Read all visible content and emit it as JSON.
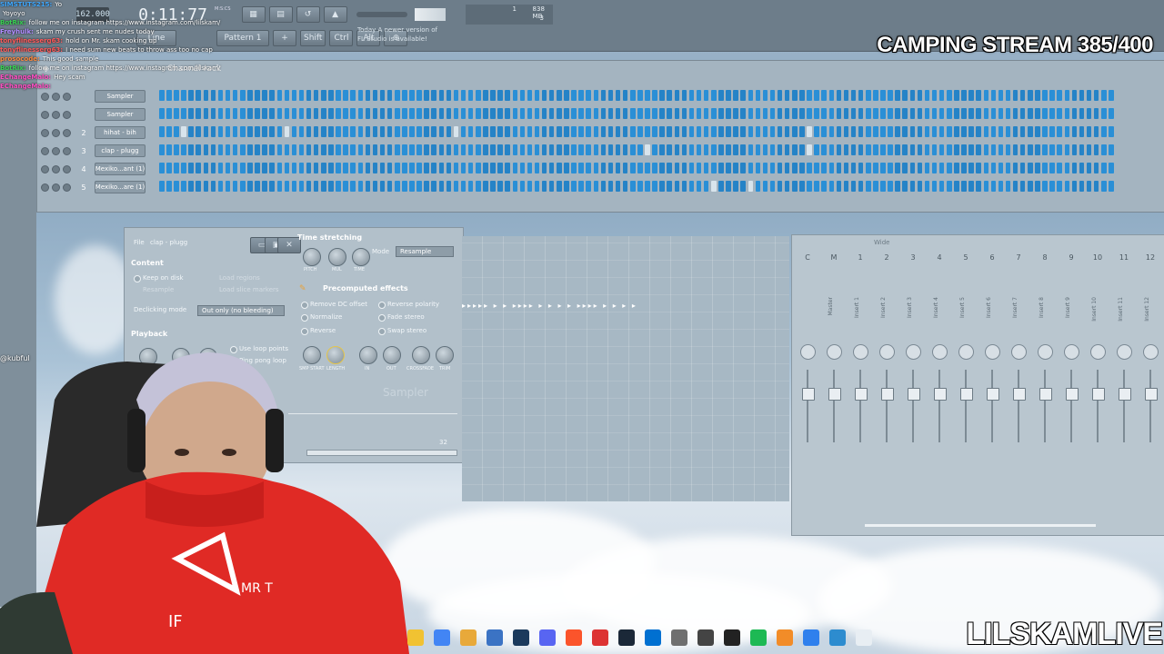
{
  "stream": {
    "title": "CAMPING STREAM 385/400",
    "watermark": "LILSKAMLIVE",
    "side_tag": "@kubful"
  },
  "fl_toolbar": {
    "tempo": "162.000",
    "time": "0:11:77",
    "time_unit": "M:S:CS",
    "pattern": "Pattern 1",
    "mode": "Line",
    "memory": "838 MB",
    "cpu": "1",
    "poly": "3",
    "hint_line1": "Today A newer version of",
    "hint_line2": "FL Studio is available!",
    "shift": "Shift",
    "ctrl": "Ctrl",
    "alt": "Alt"
  },
  "chat": [
    {
      "user": "SIMSTUTS215:",
      "text": "Yo",
      "color": "#3ea8ff"
    },
    {
      "user": "",
      "text": "Yoyoyo",
      "color": "#ffffff"
    },
    {
      "user": "BotRix:",
      "text": "follow me on instagram https://www.instagram.com/lilskam/",
      "color": "#39d353"
    },
    {
      "user": "Freyhulk:",
      "text": "skam my crush sent me nudes today",
      "color": "#b18bff"
    },
    {
      "user": "tonyflinesserg63:",
      "text": "hold on Mr. skam cooking up",
      "color": "#ff5a5a"
    },
    {
      "user": "tonyflinesserg63:",
      "text": "I need sum new beats to throw ass too no cap",
      "color": "#ff5a5a"
    },
    {
      "user": "prosocode:",
      "text": "This good sample",
      "color": "#ff8a3d"
    },
    {
      "user": "BotRix:",
      "text": "follow me on instagram https://www.instagram.com/lilskam/",
      "color": "#39d353"
    },
    {
      "user": "EChangeMalo:",
      "text": "Hey scam",
      "color": "#ff4fc3"
    },
    {
      "user": "EChangeMalo:",
      "text": "",
      "color": "#ff4fc3"
    }
  ],
  "channel_rack": {
    "title": "Channel rack",
    "channels": [
      {
        "num": "",
        "name": "Sampler"
      },
      {
        "num": "",
        "name": "Sampler"
      },
      {
        "num": "2",
        "name": "hihat - bih"
      },
      {
        "num": "3",
        "name": "clap - plugg"
      },
      {
        "num": "4",
        "name": "Mexiko...ant (1)"
      },
      {
        "num": "5",
        "name": "Mexiko...are (1)"
      }
    ]
  },
  "sampler": {
    "file_label": "File",
    "file_name": "clap - plugg",
    "content_label": "Content",
    "keep_on_disk": "Keep on disk",
    "resample": "Resample",
    "load_regions": "Load regions",
    "load_slice_markers": "Load slice markers",
    "declicking_label": "Declicking mode",
    "declicking_value": "Out only (no bleeding)",
    "time_stretching": "Time stretching",
    "mode_label": "Mode",
    "mode_value": "Resample",
    "knob_pitch": "PITCH",
    "knob_mul": "MUL",
    "knob_time": "TIME",
    "precomputed": "Precomputed effects",
    "remove_dc": "Remove DC offset",
    "normalize": "Normalize",
    "reverse": "Reverse",
    "reverse_polarity": "Reverse polarity",
    "fade_stereo": "Fade stereo",
    "swap_stereo": "Swap stereo",
    "playback": "Playback",
    "use_loop_points": "Use loop points",
    "ping_pong": "Ping pong loop",
    "knob_smp_start": "SMP START",
    "knob_length": "LENGTH",
    "knob_in": "IN",
    "knob_out": "OUT",
    "knob_crossfade": "CROSSFADE",
    "knob_trim": "TRIM",
    "brand": "Sampler",
    "counter": "32"
  },
  "mixer": {
    "header": "Wide",
    "strips": [
      {
        "num": "C",
        "name": ""
      },
      {
        "num": "M",
        "name": "Master"
      },
      {
        "num": "1",
        "name": "Insert 1"
      },
      {
        "num": "2",
        "name": "Insert 2"
      },
      {
        "num": "3",
        "name": "Insert 3"
      },
      {
        "num": "4",
        "name": "Insert 4"
      },
      {
        "num": "5",
        "name": "Insert 5"
      },
      {
        "num": "6",
        "name": "Insert 6"
      },
      {
        "num": "7",
        "name": "Insert 7"
      },
      {
        "num": "8",
        "name": "Insert 8"
      },
      {
        "num": "9",
        "name": "Insert 9"
      },
      {
        "num": "10",
        "name": "Insert 10"
      },
      {
        "num": "11",
        "name": "Insert 11"
      },
      {
        "num": "12",
        "name": "Insert 12"
      }
    ]
  },
  "taskbar_icons": [
    "file-explorer",
    "chrome",
    "folder",
    "store",
    "photoshop",
    "discord",
    "brave",
    "recorder",
    "steam",
    "ps-app",
    "gamepad",
    "4k-app",
    "capcut",
    "spotify",
    "fl-studio",
    "notes",
    "photos",
    "document"
  ],
  "colors": {
    "step_on": "#2a8fd6",
    "step_off": "#d8e4ec",
    "hoodie": "#e02a25"
  }
}
